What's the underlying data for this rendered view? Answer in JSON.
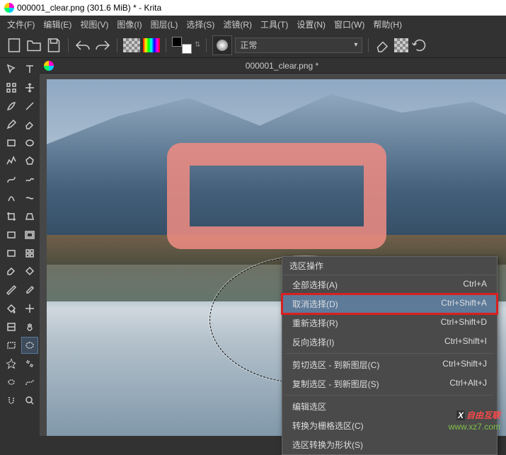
{
  "title": "000001_clear.png (301.6 MiB)  * - Krita",
  "menus": [
    "文件(F)",
    "编辑(E)",
    "视图(V)",
    "图像(I)",
    "图层(L)",
    "选择(S)",
    "滤镜(R)",
    "工具(T)",
    "设置(N)",
    "窗口(W)",
    "帮助(H)"
  ],
  "blend_mode": "正常",
  "document_tab": "000001_clear.png *",
  "context_menu": {
    "title": "选区操作",
    "items": [
      {
        "label": "全部选择(A)",
        "shortcut": "Ctrl+A"
      },
      {
        "label": "取消选择(D)",
        "shortcut": "Ctrl+Shift+A",
        "highlight": true
      },
      {
        "label": "重新选择(R)",
        "shortcut": "Ctrl+Shift+D"
      },
      {
        "label": "反向选择(I)",
        "shortcut": "Ctrl+Shift+I"
      },
      {
        "sep": true
      },
      {
        "label": "剪切选区 - 到新图层(C)",
        "shortcut": "Ctrl+Shift+J"
      },
      {
        "label": "复制选区 - 到新图层(S)",
        "shortcut": "Ctrl+Alt+J"
      },
      {
        "sep": true
      },
      {
        "label": "编辑选区",
        "shortcut": ""
      },
      {
        "label": "转换为栅格选区(C)",
        "shortcut": ""
      },
      {
        "label": "选区转换为形状(S)",
        "shortcut": ""
      }
    ]
  },
  "watermark": {
    "brand": "自由互联",
    "url": "www.xz7.com"
  },
  "tool_icons": [
    "cursor",
    "text",
    "transform",
    "move",
    "brush",
    "line",
    "pencil",
    "eraser",
    "rect",
    "ellipse",
    "polyline",
    "polygon",
    "bezier",
    "freehand",
    "calligraphy",
    "dynabrush",
    "crop",
    "perspective",
    "rect2",
    "frame",
    "gradient",
    "pattern",
    "colorize",
    "smartfill",
    "measure",
    "colorpicker",
    "fill",
    "assistant",
    "reference",
    "pan",
    "rect-select",
    "ellipse-select",
    "contiguous-select",
    "similar-select",
    "freehand-select",
    "bezier-select",
    "magnetic-select",
    "zoom"
  ],
  "active_tool_index": 31
}
